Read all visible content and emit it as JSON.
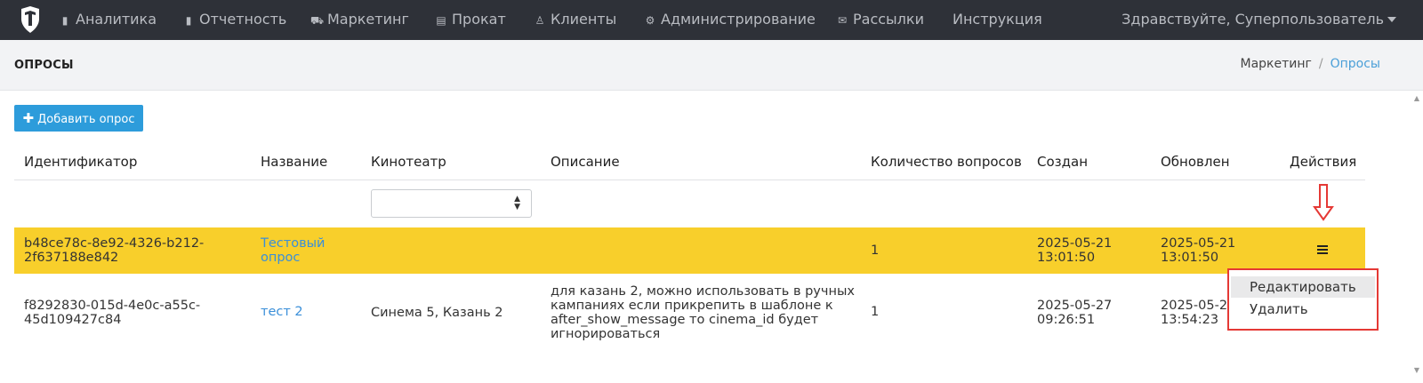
{
  "navbar": {
    "items": [
      {
        "label": "Аналитика",
        "icon": "bar-chart-icon"
      },
      {
        "label": "Отчетность",
        "icon": "bar-chart-icon"
      },
      {
        "label": "Маркетинг",
        "icon": "cart-icon"
      },
      {
        "label": "Прокат",
        "icon": "film-icon"
      },
      {
        "label": "Клиенты",
        "icon": "user-icon"
      },
      {
        "label": "Администрирование",
        "icon": "gears-icon"
      },
      {
        "label": "Рассылки",
        "icon": "envelope-icon"
      },
      {
        "label": "Инструкция",
        "icon": ""
      }
    ],
    "user_greeting": "Здравствуйте, Суперпользователь"
  },
  "page": {
    "title": "ОПРОСЫ",
    "breadcrumb": [
      "Маркетинг",
      "Опросы"
    ],
    "add_button": "Добавить опрос"
  },
  "table": {
    "columns": [
      "Идентификатор",
      "Название",
      "Кинотеатр",
      "Описание",
      "Количество вопросов",
      "Создан",
      "Обновлен",
      "Действия"
    ],
    "rows": [
      {
        "id": [
          "b48ce78c-8e92-4326-b212-",
          "2f637188e842"
        ],
        "name": [
          "Тестовый",
          "опрос"
        ],
        "cinema": "",
        "description": [],
        "questions": "1",
        "created": [
          "2025-05-21",
          "13:01:50"
        ],
        "updated": [
          "2025-05-21",
          "13:01:50"
        ]
      },
      {
        "id": [
          "f8292830-015d-4e0c-a55c-",
          "45d109427c84"
        ],
        "name": [
          "тест 2"
        ],
        "cinema": "Синема 5, Казань 2",
        "description": [
          "для казань 2, можно использовать в ручных",
          "кампаниях если прикрепить в шаблоне к",
          "after_show_message то cinema_id будет",
          "игнорироваться"
        ],
        "questions": "1",
        "created": [
          "2025-05-27",
          "09:26:51"
        ],
        "updated": [
          "2025-05-2",
          "13:54:23"
        ]
      }
    ]
  },
  "dropdown": {
    "edit": "Редактировать",
    "delete": "Удалить"
  },
  "colors": {
    "navbar": "#2e3138",
    "highlight_row": "#f8cf2b",
    "primary_button": "#2d9cdb",
    "link": "#3a8fd9",
    "annotation": "#e53935"
  }
}
